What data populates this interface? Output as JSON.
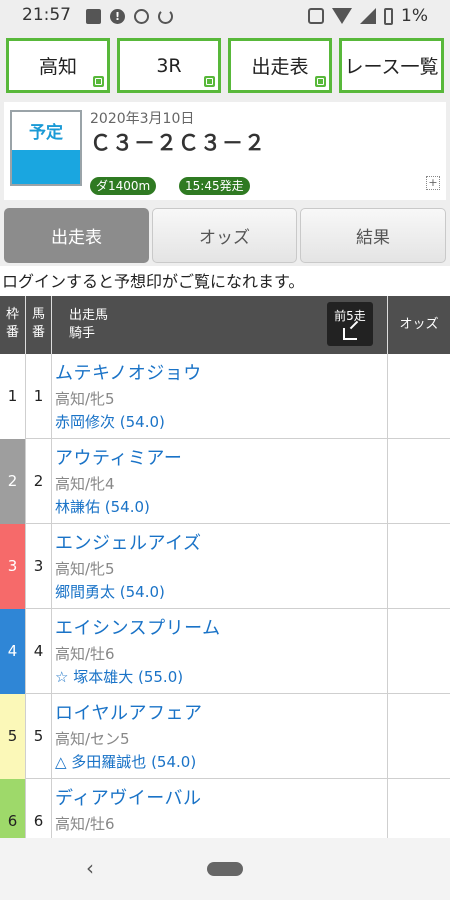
{
  "status_bar": {
    "time": "21:57",
    "battery": "1%"
  },
  "top_nav": [
    "高知",
    "3R",
    "出走表",
    "レース一覧"
  ],
  "race": {
    "status": "予定",
    "date": "2020年3月10日",
    "name": "Ｃ３－２Ｃ３－２",
    "distance": "ダ1400m",
    "start_time": "15:45発走",
    "expand_icon": "+"
  },
  "tabs": [
    "出走表",
    "オッズ",
    "結果"
  ],
  "login_notice": "ログインすると予想印がご覧になれます。",
  "table": {
    "header_waku_1": "枠",
    "header_waku_2": "番",
    "header_umaban_1": "馬",
    "header_umaban_2": "番",
    "header_horse": "出走馬",
    "header_jockey": "騎手",
    "prev5_label": "前5走",
    "header_odds": "オッズ"
  },
  "waku_colors": [
    "#ffffff",
    "#9e9e9e",
    "#f66a6a",
    "#2f86d6",
    "#fbf8b8",
    "#9ed96a"
  ],
  "waku_text_colors": [
    "#222222",
    "#ffffff",
    "#ffffff",
    "#ffffff",
    "#222222",
    "#222222"
  ],
  "entries": [
    {
      "waku": "1",
      "umaban": "1",
      "name": "ムテキノオジョウ",
      "info": "高知/牝5",
      "jockey": "赤岡修次 (54.0)"
    },
    {
      "waku": "2",
      "umaban": "2",
      "name": "アウティミアー",
      "info": "高知/牝4",
      "jockey": "林謙佑 (54.0)"
    },
    {
      "waku": "3",
      "umaban": "3",
      "name": "エンジェルアイズ",
      "info": "高知/牝5",
      "jockey": "郷間勇太 (54.0)"
    },
    {
      "waku": "4",
      "umaban": "4",
      "name": "エイシンスプリーム",
      "info": "高知/牡6",
      "jockey": "☆ 塚本雄大 (55.0)"
    },
    {
      "waku": "5",
      "umaban": "5",
      "name": "ロイヤルアフェア",
      "info": "高知/セン5",
      "jockey": "△ 多田羅誠也 (54.0)"
    },
    {
      "waku": "6",
      "umaban": "6",
      "name": "ディアヴイーバル",
      "info": "高知/牡6",
      "jockey": ""
    }
  ],
  "nav_bar": {
    "back_glyph": "‹"
  }
}
